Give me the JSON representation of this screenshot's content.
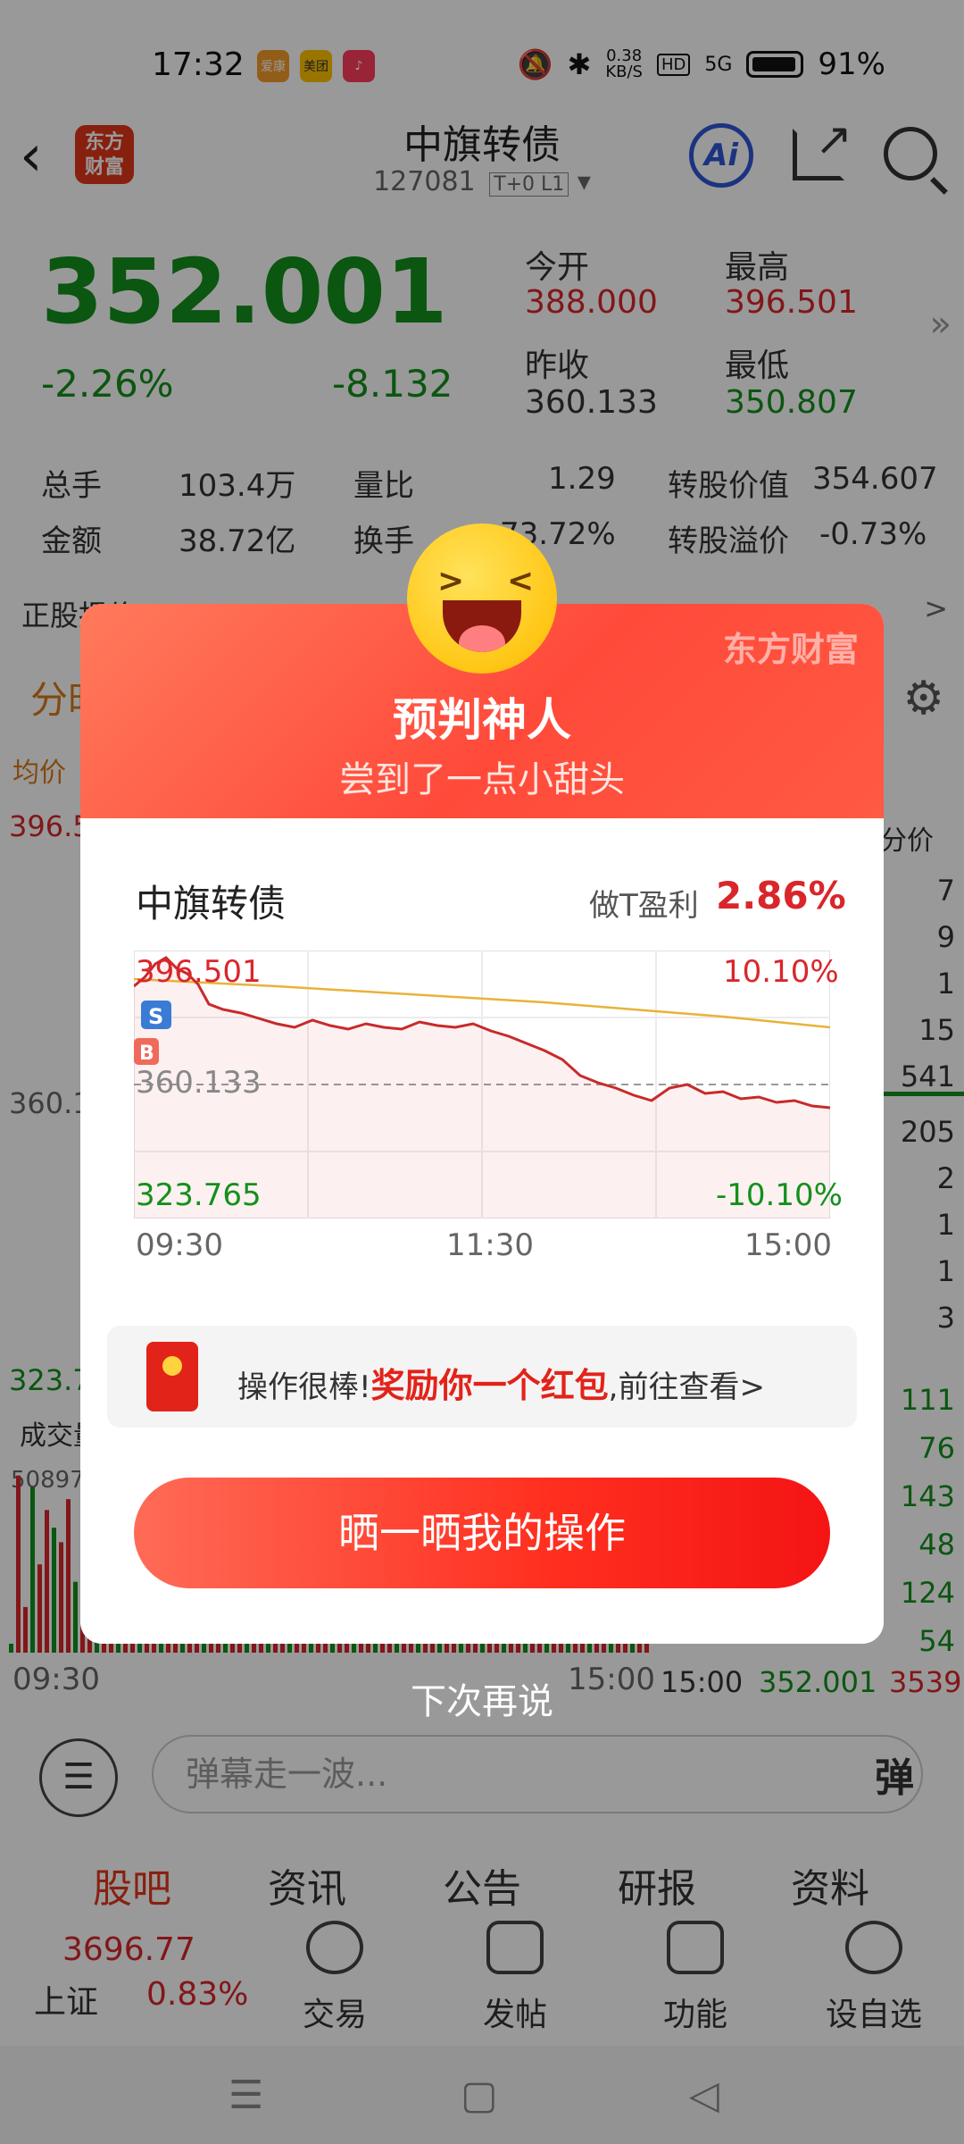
{
  "status": {
    "time": "17:32",
    "apps": [
      {
        "name": "爱康",
        "color": "#f39b2a"
      },
      {
        "name": "美团",
        "color": "#ffc300"
      },
      {
        "name": "♪",
        "color": "#ff3b5c"
      }
    ],
    "net_speed": "0.38",
    "net_unit": "KB/S",
    "hd": "HD",
    "signal": "5G",
    "battery": "91%"
  },
  "header": {
    "logo": "东方财富",
    "title": "中旗转债",
    "code": "127081",
    "badges": "T+0 L1",
    "ai_label": "Ai"
  },
  "quote": {
    "price": "352.001",
    "change_pct": "-2.26%",
    "change_amt": "-8.132",
    "labels": {
      "open": "今开",
      "high": "最高",
      "prev_close": "昨收",
      "low": "最低"
    },
    "open": "388.000",
    "high": "396.501",
    "prev_close": "360.133",
    "low": "350.807"
  },
  "stats": {
    "volume_label": "总手",
    "volume": "103.4万",
    "ratio_label": "量比",
    "ratio": "1.29",
    "conv_value_label": "转股价值",
    "conv_value": "354.607",
    "amount_label": "金额",
    "amount": "38.72亿",
    "turnover_label": "换手",
    "turnover": "73.72%",
    "premium_label": "转股溢价",
    "premium": "-0.73%"
  },
  "ticker": {
    "text": "正股报价"
  },
  "chart_tabs": {
    "active": "分时"
  },
  "chart_side": {
    "avg_label": "均价",
    "high_clip": "396.5",
    "mid_clip": "360.1",
    "low_clip": "323.7",
    "vol_label": "成交量",
    "vol_clip": "50897",
    "time_start": "09:30",
    "time_end": "15:00",
    "right_header": "分价",
    "right_top": [
      "7",
      "9",
      "1",
      "15",
      "541",
      "205",
      "2",
      "1",
      "1",
      "3"
    ],
    "right_bottom": [
      "111",
      "76",
      "143",
      "48",
      "124",
      "54"
    ],
    "last_row_time": "15:00",
    "last_row_price": "352.001",
    "last_row_vol": "3539"
  },
  "danmu": {
    "placeholder": "弹幕走一波...",
    "btn": "弹"
  },
  "bottom_tabs": [
    "股吧",
    "资讯",
    "公告",
    "研报",
    "资料"
  ],
  "toolbar": {
    "index_value": "3696.77",
    "index_name": "上证",
    "index_pct": "0.83%",
    "items": [
      "交易",
      "发帖",
      "功能",
      "设自选"
    ]
  },
  "modal": {
    "brand": "东方财富",
    "title": "预判神人",
    "subtitle": "尝到了一点小甜头",
    "stock": "中旗转债",
    "profit_label": "做T盈利",
    "profit_value": "2.86%",
    "chart": {
      "top_price": "396.501",
      "top_pct": "10.10%",
      "mid_price": "360.133",
      "bottom_price": "323.765",
      "bottom_pct": "-10.10%",
      "times": [
        "09:30",
        "11:30",
        "15:00"
      ],
      "sell_mark": "S",
      "buy_mark": "B"
    },
    "reward_prefix": "操作很棒!",
    "reward_highlight": "奖励你一个红包",
    "reward_suffix": ",前往查看>",
    "share_button": "晒一晒我的操作",
    "dismiss": "下次再说"
  },
  "colors": {
    "up": "#d9262b",
    "down": "#13901c",
    "accent": "#e3361b"
  }
}
